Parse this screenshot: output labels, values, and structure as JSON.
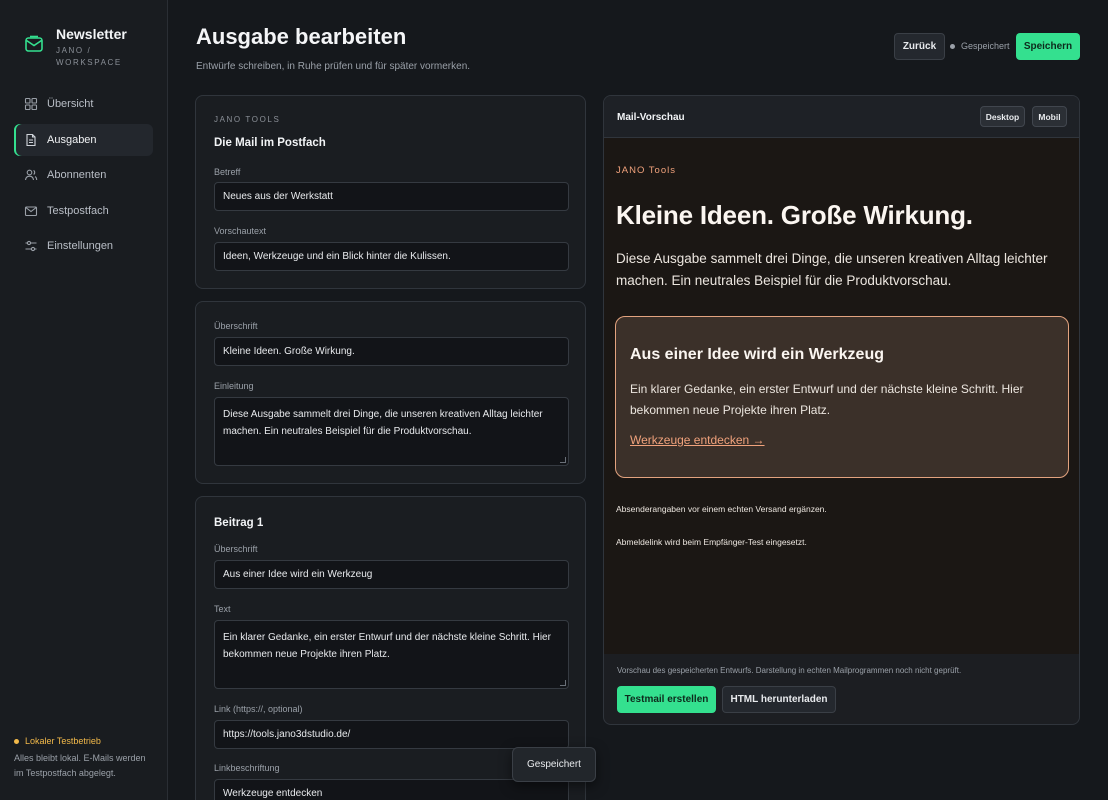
{
  "app": {
    "title": "Newsletter",
    "subtitle": "JANO / WORKSPACE"
  },
  "sidebar": {
    "items": [
      {
        "label": "Übersicht",
        "icon": "grid-icon",
        "active": false
      },
      {
        "label": "Ausgaben",
        "icon": "document-icon",
        "active": true
      },
      {
        "label": "Abonnenten",
        "icon": "users-icon",
        "active": false
      },
      {
        "label": "Testpostfach",
        "icon": "mail-icon",
        "active": false
      },
      {
        "label": "Einstellungen",
        "icon": "sliders-icon",
        "active": false
      }
    ],
    "footer": {
      "title": "Lokaler Testbetrieb",
      "text": "Alles bleibt lokal. E-Mails werden im Testpostfach abgelegt."
    }
  },
  "header": {
    "title": "Ausgabe bearbeiten",
    "subtitle": "Entwürfe schreiben, in Ruhe prüfen und für später vormerken.",
    "back_label": "Zurück",
    "status": "Gespeichert",
    "save_label": "Speichern"
  },
  "form": {
    "mail": {
      "eyebrow": "JANO TOOLS",
      "title": "Die Mail im Postfach",
      "subject_label": "Betreff",
      "subject_value": "Neues aus der Werkstatt",
      "preheader_label": "Vorschautext",
      "preheader_value": "Ideen, Werkzeuge und ein Blick hinter die Kulissen."
    },
    "intro": {
      "heading_label": "Überschrift",
      "heading_value": "Kleine Ideen. Große Wirkung.",
      "intro_label": "Einleitung",
      "intro_value": "Diese Ausgabe sammelt drei Dinge, die unseren kreativen Alltag leichter machen. Ein neutrales Beispiel für die Produktvorschau."
    },
    "post1": {
      "title": "Beitrag 1",
      "heading_label": "Überschrift",
      "heading_value": "Aus einer Idee wird ein Werkzeug",
      "text_label": "Text",
      "text_value": "Ein klarer Gedanke, ein erster Entwurf und der nächste kleine Schritt. Hier bekommen neue Projekte ihren Platz.",
      "link_label": "Link (https://, optional)",
      "link_value": "https://tools.jano3dstudio.de/",
      "link_text_label": "Linkbeschriftung",
      "link_text_value": "Werkzeuge entdecken"
    }
  },
  "preview": {
    "title": "Mail-Vorschau",
    "tab_desktop": "Desktop",
    "tab_mobile": "Mobil",
    "brand": "JANO Tools",
    "headline": "Kleine Ideen. Große Wirkung.",
    "intro": "Diese Ausgabe sammelt drei Dinge, die unseren kreativen Alltag leichter machen. Ein neutrales Beispiel für die Produktvorschau.",
    "card_title": "Aus einer Idee wird ein Werkzeug",
    "card_text": "Ein klarer Gedanke, ein erster Entwurf und der nächste kleine Schritt. Hier bekommen neue Projekte ihren Platz.",
    "card_link": "Werkzeuge entdecken →",
    "note_sender": "Absenderangaben vor einem echten Versand ergänzen.",
    "note_unsubscribe": "Abmeldelink wird beim Empfänger-Test eingesetzt.",
    "footer_text": "Vorschau des gespeicherten Entwurfs. Darstellung in echten Mailprogrammen noch nicht geprüft.",
    "btn_testmail": "Testmail erstellen",
    "btn_html": "HTML herunterladen"
  },
  "toast": "Gespeichert",
  "colors": {
    "accent": "#34e08f",
    "warning": "#f2b94a",
    "mail_accent": "#f1a27c"
  }
}
